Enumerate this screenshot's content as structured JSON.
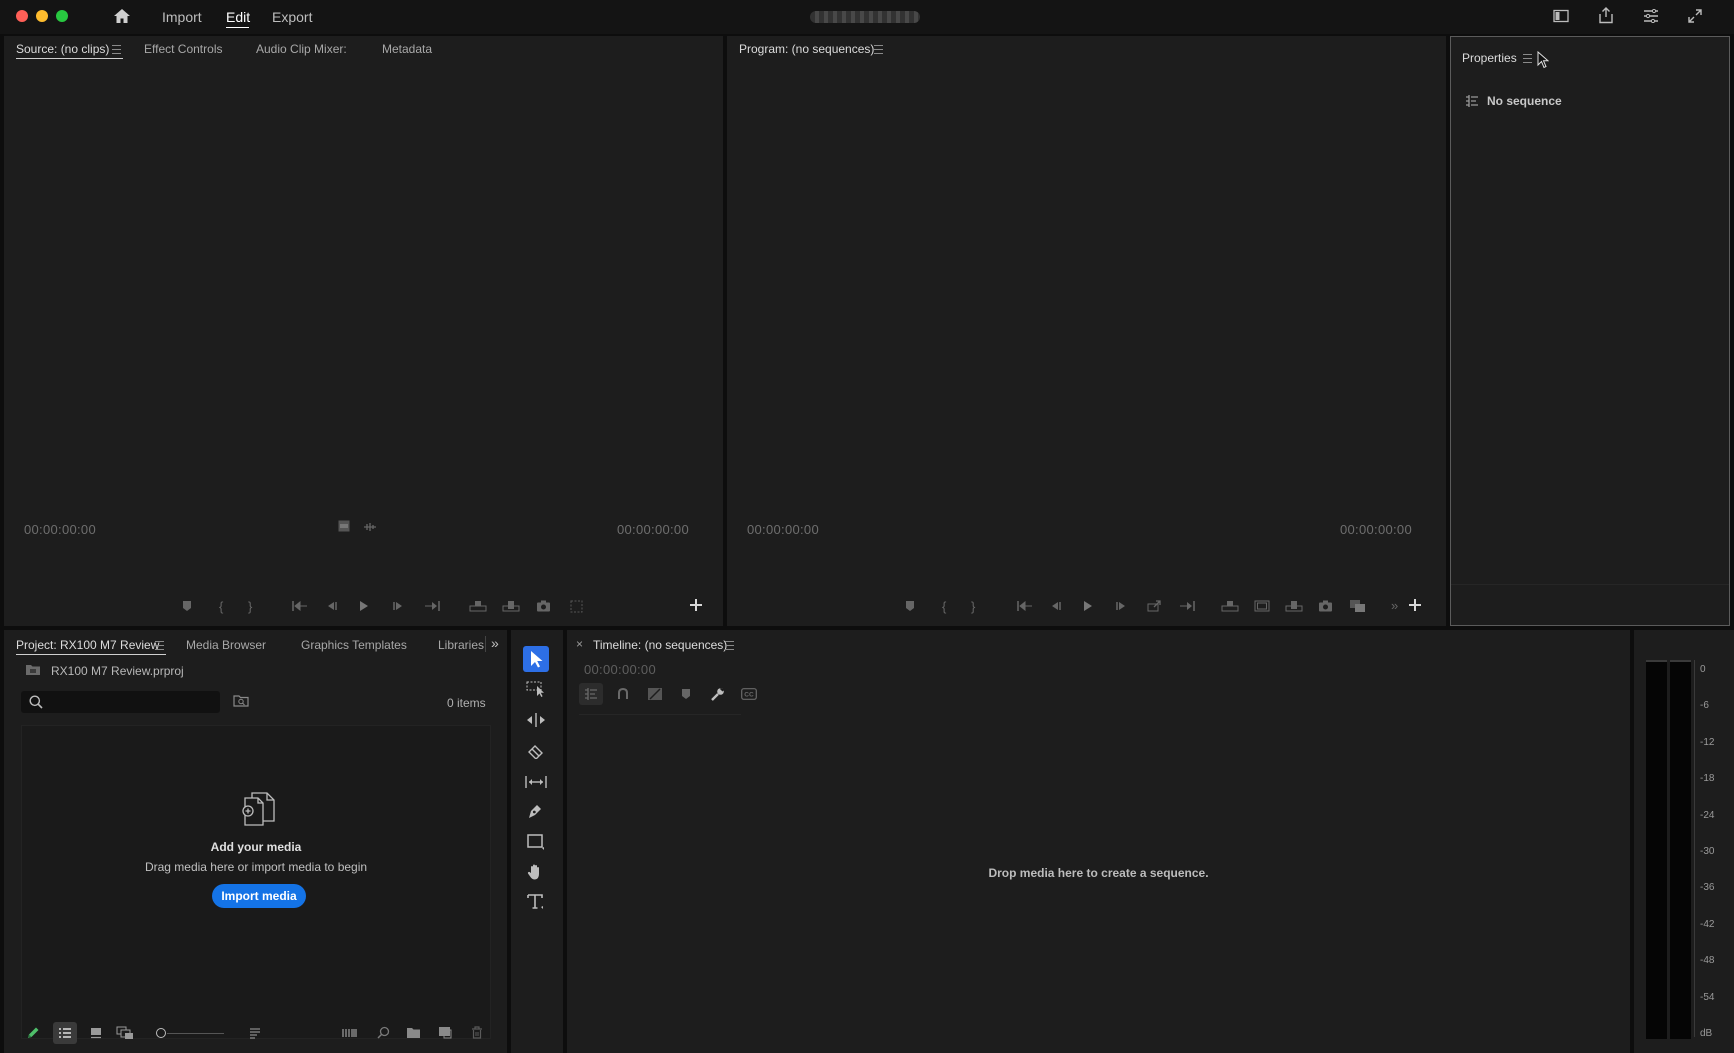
{
  "menu": {
    "import": "Import",
    "edit": "Edit",
    "export": "Export",
    "active": "Edit"
  },
  "source_panel": {
    "tabs": [
      "Source: (no clips)",
      "Effect Controls",
      "Audio Clip Mixer:",
      "Metadata"
    ],
    "timecode_in": "00:00:00:00",
    "timecode_out": "00:00:00:00"
  },
  "program_panel": {
    "title": "Program: (no sequences)",
    "timecode_in": "00:00:00:00",
    "timecode_out": "00:00:00:00"
  },
  "properties_panel": {
    "title": "Properties",
    "message": "No sequence"
  },
  "project_panel": {
    "tabs": [
      "Project: RX100 M7 Review",
      "Media Browser",
      "Graphics Templates",
      "Libraries"
    ],
    "file_name": "RX100 M7 Review.prproj",
    "search_placeholder": "",
    "item_count": "0 items",
    "empty_title": "Add your media",
    "empty_subtitle": "Drag media here or import media to begin",
    "import_button": "Import media"
  },
  "timeline_panel": {
    "title": "Timeline: (no sequences)",
    "timecode": "00:00:00:00",
    "drop_message": "Drop media here to create a sequence."
  },
  "audio_meter": {
    "labels": [
      "0",
      "-6",
      "-12",
      "-18",
      "-24",
      "-30",
      "-36",
      "-42",
      "-48",
      "-54",
      "dB"
    ]
  },
  "colors": {
    "accent_blue": "#1473e6",
    "tool_active": "#2d6fe6",
    "pen_green": "#4fbf6a",
    "close_red": "#ff5f57",
    "minimize_yellow": "#febc2e",
    "maximize_green": "#28c840"
  }
}
